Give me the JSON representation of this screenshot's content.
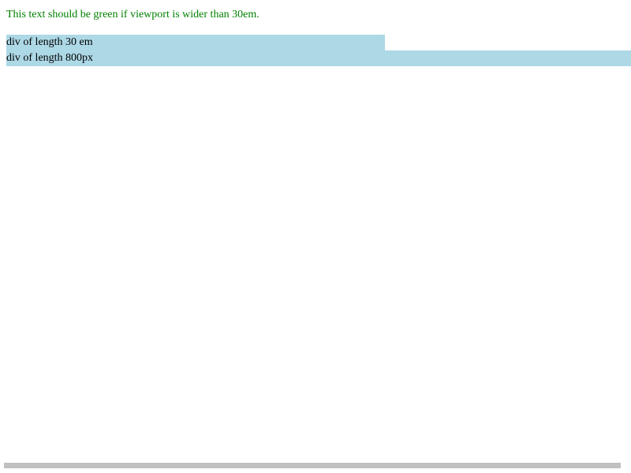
{
  "test_text": "This text should be green if viewport is wider than 30em.",
  "boxes": {
    "em_label": "div of length 30 em",
    "px_label": "div of length 800px"
  },
  "colors": {
    "test_text": "#008000",
    "box_background": "#add8e6",
    "scrollbar": "#c0c0c0"
  }
}
